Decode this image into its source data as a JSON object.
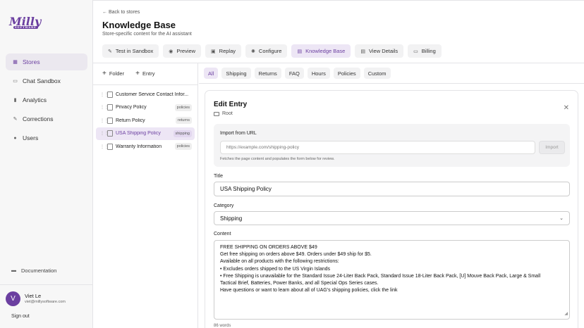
{
  "brand": {
    "logo_text": "Milly",
    "logo_sub": "SOFTWARE"
  },
  "sidebar": {
    "items": [
      {
        "label": "Stores",
        "icon": "store-icon"
      },
      {
        "label": "Chat Sandbox",
        "icon": "chat-icon"
      },
      {
        "label": "Analytics",
        "icon": "analytics-icon"
      },
      {
        "label": "Corrections",
        "icon": "pencil-icon"
      },
      {
        "label": "Users",
        "icon": "users-icon"
      }
    ],
    "documentation": "Documentation",
    "user": {
      "initial": "V",
      "name": "Viet Le",
      "email": "viet@millysoftware.com"
    },
    "sign_out": "Sign out"
  },
  "header": {
    "back": "← Back to stores",
    "title": "Knowledge Base",
    "subtitle": "Store-specific content for the AI assistant",
    "tabs": [
      {
        "label": "Test in Sandbox",
        "icon": "pencil-icon"
      },
      {
        "label": "Preview",
        "icon": "eye-icon"
      },
      {
        "label": "Replay",
        "icon": "replay-icon"
      },
      {
        "label": "Configure",
        "icon": "gear-icon"
      },
      {
        "label": "Knowledge Base",
        "icon": "book-icon"
      },
      {
        "label": "View Details",
        "icon": "details-icon"
      },
      {
        "label": "Billing",
        "icon": "card-icon"
      }
    ]
  },
  "tree": {
    "folder_btn": "Folder",
    "entry_btn": "Entry",
    "entries": [
      {
        "title": "Customer Service Contact Infor...",
        "tag": ""
      },
      {
        "title": "Privacy Policy",
        "tag": "policies"
      },
      {
        "title": "Return Policy",
        "tag": "returns"
      },
      {
        "title": "USA Shipping Policy",
        "tag": "shipping"
      },
      {
        "title": "Warranty Information",
        "tag": "policies"
      }
    ]
  },
  "filters": [
    "All",
    "Shipping",
    "Returns",
    "FAQ",
    "Hours",
    "Policies",
    "Custom"
  ],
  "editor": {
    "title": "Edit Entry",
    "root": "Root",
    "import_label": "Import from URL",
    "import_placeholder": "https://example.com/shipping-policy",
    "import_button": "Import",
    "import_help": "Fetches the page content and populates the form below for review.",
    "title_label": "Title",
    "title_value": "USA Shipping Policy",
    "category_label": "Category",
    "category_value": "Shipping",
    "content_label": "Content",
    "content_lines": [
      "FREE SHIPPING ON ORDERS ABOVE $49",
      "Get free shipping on orders above $49. Orders under $49 ship for $5.",
      "Available on all products with the following restrictions:",
      "• Excludes orders shipped to the US Virgin Islands",
      "• Free Shipping is unavailable for the Standard Issue 24-Liter Back Pack, Standard Issue 18-Liter Back Pack, [U] Mouve Back Pack, Large & Small",
      "Tactical Brief, Batteries, Power Banks, and all Special Ops Series cases.",
      "Have questions or want to learn about all of UAG's shipping policies, click the link"
    ],
    "word_count": "86 words"
  },
  "colors": {
    "accent": "#6b3fa0",
    "accent_bg": "#ede6f5"
  }
}
